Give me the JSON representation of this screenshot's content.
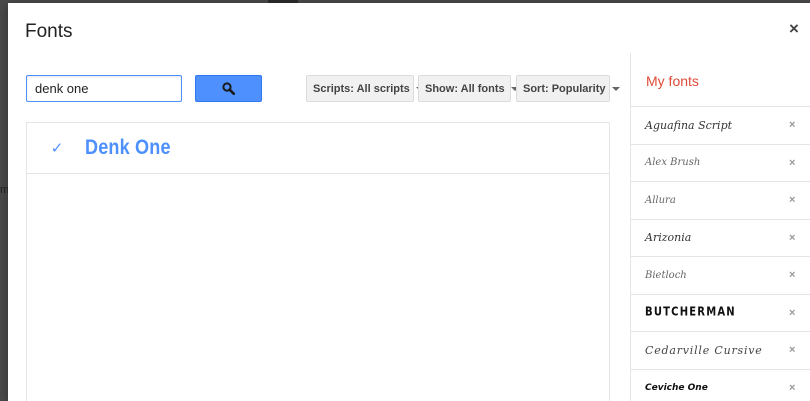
{
  "dialog": {
    "title": "Fonts",
    "close_label": "×"
  },
  "search": {
    "value": "denk one",
    "button_icon": "search-icon"
  },
  "filters": {
    "scripts_label": "Scripts: All scripts",
    "show_label": "Show: All fonts",
    "sort_label": "Sort: Popularity"
  },
  "results": [
    {
      "name": "Denk One",
      "selected": true,
      "check": "✓"
    }
  ],
  "my_fonts": {
    "title": "My fonts",
    "remove_label": "×",
    "items": [
      {
        "name": "Aguafina Script"
      },
      {
        "name": "Alex Brush"
      },
      {
        "name": "Allura"
      },
      {
        "name": "Arizonia"
      },
      {
        "name": "Bietloch"
      },
      {
        "name": "BUTCHERMAN"
      },
      {
        "name": "Cedarville Cursive"
      },
      {
        "name": "Ceviche One"
      }
    ]
  },
  "colors": {
    "accent": "#4d90fe",
    "my_fonts_title": "#dd4b39"
  }
}
